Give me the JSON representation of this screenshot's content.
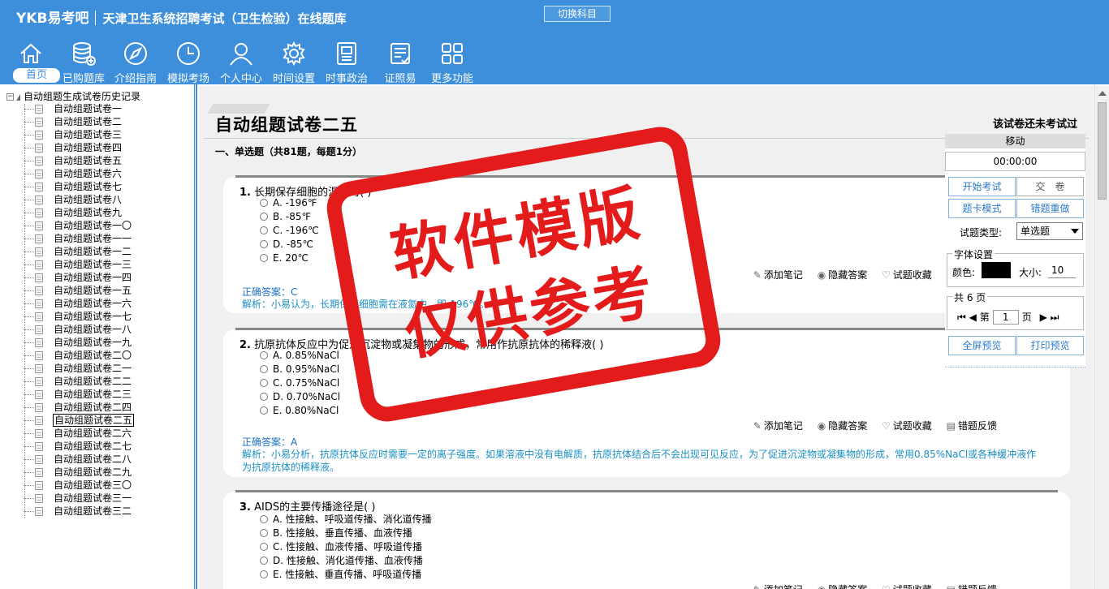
{
  "header": {
    "logo": "YKB易考吧",
    "title": "天津卫生系统招聘考试（卫生检验）在线题库",
    "switch_button": "切换科目"
  },
  "nav": [
    {
      "label": "首页",
      "icon": "home-icon"
    },
    {
      "label": "已购题库",
      "icon": "database-icon"
    },
    {
      "label": "介绍指南",
      "icon": "compass-icon"
    },
    {
      "label": "模拟考场",
      "icon": "clock-icon"
    },
    {
      "label": "个人中心",
      "icon": "user-icon"
    },
    {
      "label": "时间设置",
      "icon": "gear-icon"
    },
    {
      "label": "时事政治",
      "icon": "newspaper-icon"
    },
    {
      "label": "证照易",
      "icon": "document-icon"
    },
    {
      "label": "更多功能",
      "icon": "grid-icon"
    }
  ],
  "tree": {
    "root": "自动组题生成试卷历史记录",
    "items": [
      "自动组题试卷一",
      "自动组题试卷二",
      "自动组题试卷三",
      "自动组题试卷四",
      "自动组题试卷五",
      "自动组题试卷六",
      "自动组题试卷七",
      "自动组题试卷八",
      "自动组题试卷九",
      "自动组题试卷一〇",
      "自动组题试卷一一",
      "自动组题试卷一二",
      "自动组题试卷一三",
      "自动组题试卷一四",
      "自动组题试卷一五",
      "自动组题试卷一六",
      "自动组题试卷一七",
      "自动组题试卷一八",
      "自动组题试卷一九",
      "自动组题试卷二〇",
      "自动组题试卷二一",
      "自动组题试卷二二",
      "自动组题试卷二三",
      "自动组题试卷二四",
      "自动组题试卷二五",
      "自动组题试卷二六",
      "自动组题试卷二七",
      "自动组题试卷二八",
      "自动组题试卷二九",
      "自动组题试卷三〇",
      "自动组题试卷三一",
      "自动组题试卷三二"
    ],
    "selected": "自动组题试卷二五"
  },
  "paper": {
    "title": "自动组题试卷二五",
    "status": "该试卷还未考试过",
    "section": "一、单选题（共81题，每题1分）"
  },
  "actions": {
    "add_note": "添加笔记",
    "hide_answer": "隐藏答案",
    "favorite": "试题收藏",
    "feedback": "错题反馈"
  },
  "questions": [
    {
      "num": "1.",
      "stem": "长期保存细胞的温度为( )",
      "options": [
        "A. -196℉",
        "B. -85℉",
        "C. -196℃",
        "D. -85℃",
        "E. 20℃"
      ],
      "answer": "正确答案：C",
      "analysis": "解析：小易认为，长期保存细胞需在液氮中，即-196℃。"
    },
    {
      "num": "2.",
      "stem": "抗原抗体反应中为促进沉淀物或凝集物的形成，常用作抗原抗体的稀释液( )",
      "options": [
        "A. 0.85%NaCl",
        "B. 0.95%NaCl",
        "C. 0.75%NaCl",
        "D. 0.70%NaCl",
        "E. 0.80%NaCl"
      ],
      "answer": "正确答案：A",
      "analysis": "解析：小易分析，抗原抗体反应时需要一定的离子强度。如果溶液中没有电解质，抗原抗体结合后不会出现可见反应，为了促进沉淀物或凝集物的形成，常用0.85%NaCl或各种缓冲液作为抗原抗体的稀释液。"
    },
    {
      "num": "3.",
      "stem": "AIDS的主要传播途径是( )",
      "options": [
        "A. 性接触、呼吸道传播、消化道传播",
        "B. 性接触、垂直传播、血液传播",
        "C. 性接触、血液传播、呼吸道传播",
        "D. 性接触、消化道传播、血液传播",
        "E. 性接触、垂直传播、呼吸道传播"
      ]
    }
  ],
  "stamp": {
    "line1": "软件模版",
    "line2": "仅供参考"
  },
  "panel": {
    "move": "移动",
    "timer": "00:00:00",
    "start": "开始考试",
    "submit": "交　卷",
    "card_mode": "题卡模式",
    "redo_wrong": "错题重做",
    "type_label": "试题类型:",
    "type_value": "单选题",
    "font_legend": "字体设置",
    "color_label": "颜色:",
    "font_color": "#000000",
    "size_label": "大小:",
    "size_value": "10",
    "pages_legend": "共 6 页",
    "page_prefix": "第",
    "page_value": "1",
    "page_suffix": "页",
    "fullscreen": "全屏预览",
    "print": "打印预览"
  },
  "colors": {
    "brand": "#3d8fdc",
    "stamp": "#e31b1b",
    "answer": "#1a6fc4"
  }
}
